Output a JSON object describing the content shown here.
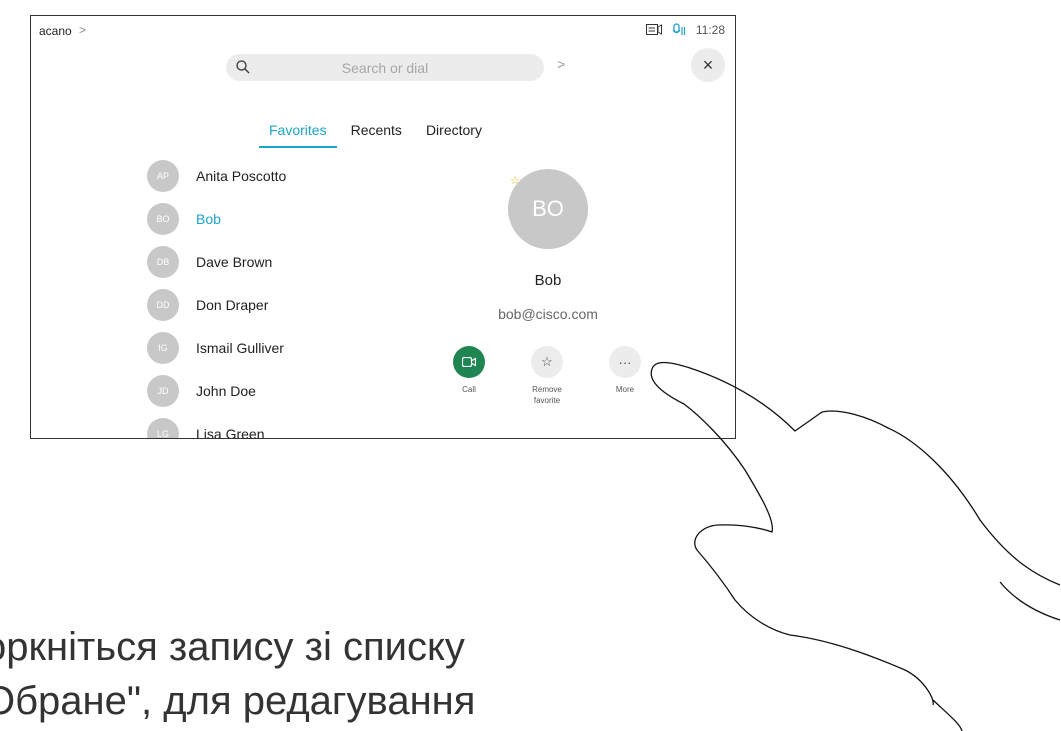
{
  "topbar": {
    "site": "acano",
    "chevron": ">",
    "time": "11:28"
  },
  "search": {
    "placeholder": "Search or dial",
    "chevron": ">",
    "close": "×"
  },
  "tabs": [
    {
      "label": "Favorites",
      "active": true
    },
    {
      "label": "Recents",
      "active": false
    },
    {
      "label": "Directory",
      "active": false
    }
  ],
  "contacts": [
    {
      "initials": "AP",
      "name": "Anita Poscotto"
    },
    {
      "initials": "BO",
      "name": "Bob",
      "selected": true
    },
    {
      "initials": "DB",
      "name": "Dave Brown"
    },
    {
      "initials": "DD",
      "name": "Don Draper"
    },
    {
      "initials": "IG",
      "name": "Ismail Gulliver"
    },
    {
      "initials": "JD",
      "name": "John Doe"
    },
    {
      "initials": "LG",
      "name": "Lisa Green"
    }
  ],
  "detail": {
    "initials": "BO",
    "name": "Bob",
    "email": "bob@cisco.com",
    "star": "☆"
  },
  "actions": [
    {
      "label": "Call",
      "icon": "video-icon",
      "glyph": "▭"
    },
    {
      "label": "Remove favorite",
      "icon": "star-icon",
      "glyph": "☆"
    },
    {
      "label": "More",
      "icon": "more-icon",
      "glyph": "···"
    }
  ],
  "caption": {
    "line1": "оркніться запису зі списку",
    "line2": "Обране\", для редагування"
  },
  "colors": {
    "accent": "#1ea4c8",
    "call": "#1f8552",
    "avatar": "#c8c8c8"
  }
}
